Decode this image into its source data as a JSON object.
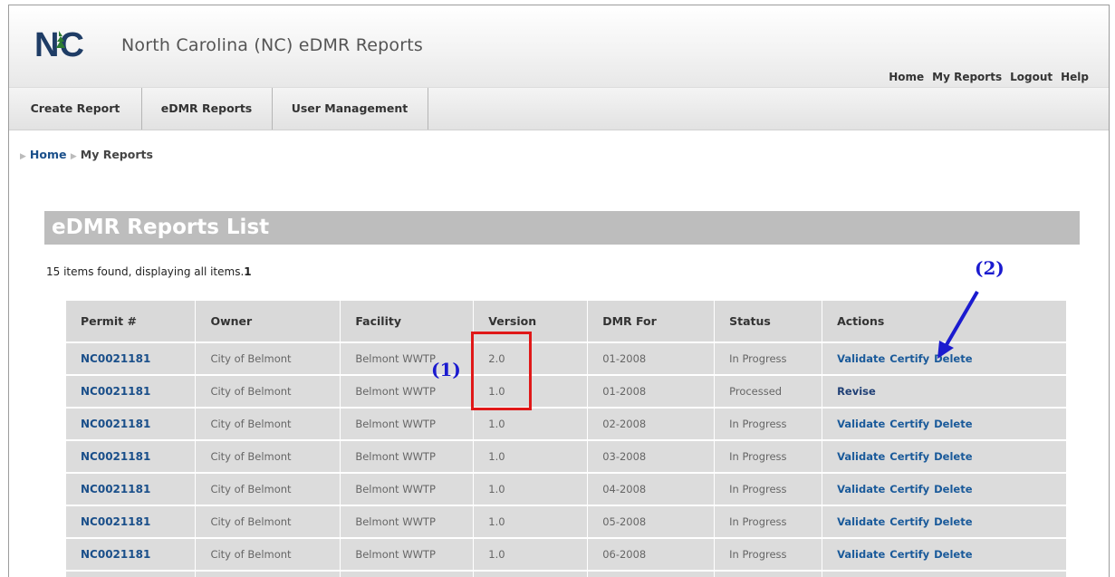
{
  "header": {
    "logo_text": "NC",
    "title": "North Carolina (NC) eDMR Reports",
    "links": [
      "Home",
      "My Reports",
      "Logout",
      "Help"
    ]
  },
  "nav": {
    "tabs": [
      "Create Report",
      "eDMR Reports",
      "User Management"
    ]
  },
  "breadcrumb": {
    "home": "Home",
    "current": "My Reports"
  },
  "list": {
    "title": "eDMR Reports List",
    "items_found": "15 items found, displaying all items.",
    "page": "1",
    "columns": [
      "Permit #",
      "Owner",
      "Facility",
      "Version",
      "DMR For",
      "Status",
      "Actions"
    ],
    "rows": [
      {
        "permit": "NC0021181",
        "owner": "City of Belmont",
        "facility": "Belmont WWTP",
        "version": "2.0",
        "dmr_for": "01-2008",
        "status": "In Progress",
        "actions": [
          "Validate",
          "Certify",
          "Delete"
        ]
      },
      {
        "permit": "NC0021181",
        "owner": "City of Belmont",
        "facility": "Belmont WWTP",
        "version": "1.0",
        "dmr_for": "01-2008",
        "status": "Processed",
        "actions": [
          "Revise"
        ]
      },
      {
        "permit": "NC0021181",
        "owner": "City of Belmont",
        "facility": "Belmont WWTP",
        "version": "1.0",
        "dmr_for": "02-2008",
        "status": "In Progress",
        "actions": [
          "Validate",
          "Certify",
          "Delete"
        ]
      },
      {
        "permit": "NC0021181",
        "owner": "City of Belmont",
        "facility": "Belmont WWTP",
        "version": "1.0",
        "dmr_for": "03-2008",
        "status": "In Progress",
        "actions": [
          "Validate",
          "Certify",
          "Delete"
        ]
      },
      {
        "permit": "NC0021181",
        "owner": "City of Belmont",
        "facility": "Belmont WWTP",
        "version": "1.0",
        "dmr_for": "04-2008",
        "status": "In Progress",
        "actions": [
          "Validate",
          "Certify",
          "Delete"
        ]
      },
      {
        "permit": "NC0021181",
        "owner": "City of Belmont",
        "facility": "Belmont WWTP",
        "version": "1.0",
        "dmr_for": "05-2008",
        "status": "In Progress",
        "actions": [
          "Validate",
          "Certify",
          "Delete"
        ]
      },
      {
        "permit": "NC0021181",
        "owner": "City of Belmont",
        "facility": "Belmont WWTP",
        "version": "1.0",
        "dmr_for": "06-2008",
        "status": "In Progress",
        "actions": [
          "Validate",
          "Certify",
          "Delete"
        ]
      }
    ]
  },
  "annotations": {
    "label1": "(1)",
    "label2": "(2)",
    "box_color": "#e01818",
    "text_color": "#1b1bcf"
  }
}
